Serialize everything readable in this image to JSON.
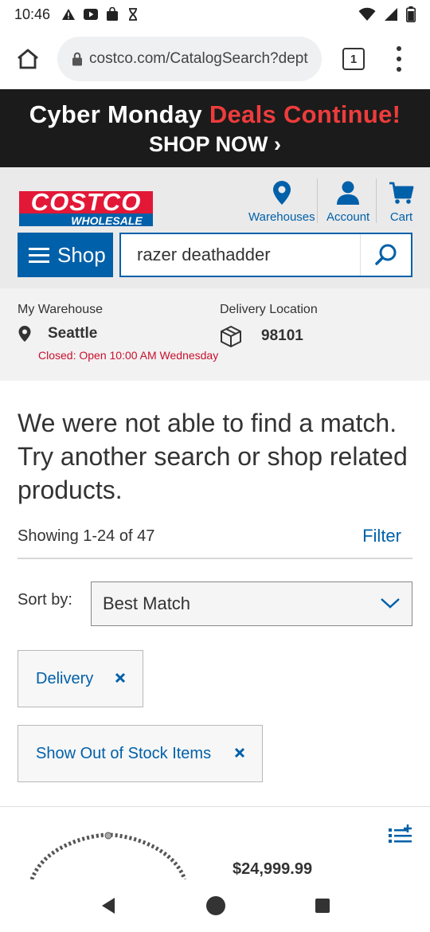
{
  "status_bar": {
    "time": "10:46"
  },
  "browser": {
    "url": "costco.com/CatalogSearch?dept",
    "tab_count": "1"
  },
  "banner": {
    "line1_white": "Cyber Monday ",
    "line1_red": "Deals Continue!",
    "line2": "SHOP NOW ›"
  },
  "header": {
    "warehouses_label": "Warehouses",
    "account_label": "Account",
    "cart_label": "Cart",
    "shop_label": "Shop",
    "search_value": "razer deathadder"
  },
  "location": {
    "warehouse_caption": "My Warehouse",
    "warehouse_name": "Seattle",
    "warehouse_status": "Closed: Open 10:00 AM Wednesday",
    "delivery_caption": "Delivery Location",
    "delivery_zip": "98101"
  },
  "results": {
    "no_match_message": "We were not able to find a match. Try another search or shop related products.",
    "showing_text": "Showing 1-24 of 47",
    "filter_label": "Filter",
    "sort_label": "Sort by:",
    "sort_value": "Best Match",
    "chips": [
      {
        "label": "Delivery"
      },
      {
        "label": "Show Out of Stock Items"
      }
    ],
    "first_price": "$24,999.99"
  },
  "colors": {
    "costco_blue": "#0060a9",
    "costco_red": "#e31837",
    "banner_bg": "#1b1b1b",
    "banner_red": "#ee3c3c"
  }
}
